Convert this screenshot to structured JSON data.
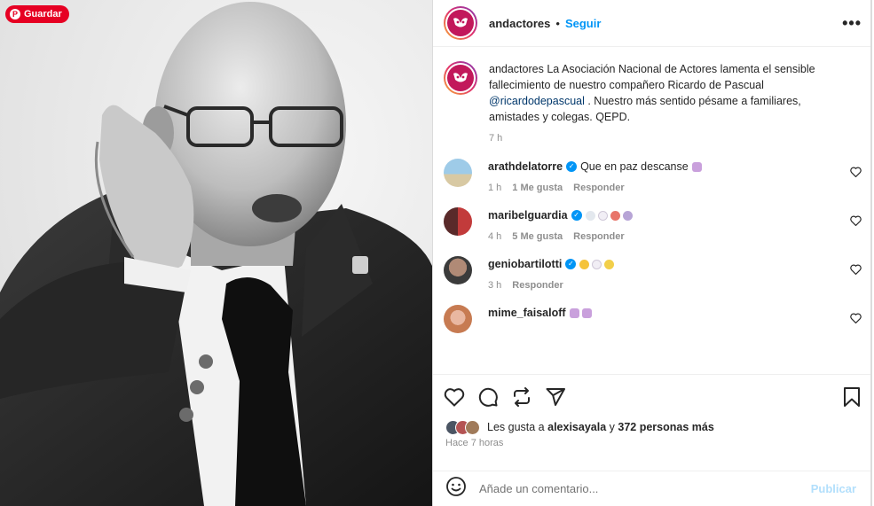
{
  "photo": {
    "save_button_label": "Guardar",
    "save_icon": "pinterest-icon"
  },
  "header": {
    "username": "andactores",
    "separator": "•",
    "follow_label": "Seguir",
    "more_label": "•••"
  },
  "caption": {
    "username": "andactores",
    "text_before": " La Asociación Nacional de Actores lamenta el sensible fallecimiento de nuestro compañero Ricardo de Pascual ",
    "mention": "@ricardodepascual",
    "text_after": " . Nuestro más sentido pésame a familiares, amistades y colegas. QEPD.",
    "time": "7 h"
  },
  "comments": [
    {
      "username": "arathdelatorre",
      "verified": true,
      "text": "Que en paz descanse",
      "emojis": [
        "folded-hands"
      ],
      "time": "1 h",
      "likes": "1 Me gusta",
      "reply": "Responder"
    },
    {
      "username": "maribelguardia",
      "verified": true,
      "text": "",
      "emojis": [
        "dove",
        "white-heart",
        "rose",
        "wing"
      ],
      "time": "4 h",
      "likes": "5 Me gusta",
      "reply": "Responder"
    },
    {
      "username": "geniobartilotti",
      "verified": true,
      "text": "",
      "emojis": [
        "sparkles",
        "white-heart",
        "dizzy"
      ],
      "time": "3 h",
      "likes": "",
      "reply": "Responder"
    },
    {
      "username": "mime_faisaloff",
      "verified": false,
      "text": "",
      "emojis": [
        "folded-hands",
        "folded-hands"
      ],
      "time": "",
      "likes": "",
      "reply": ""
    }
  ],
  "actions": {
    "icons": [
      "heart-icon",
      "comment-icon",
      "repost-icon",
      "share-icon",
      "bookmark-icon"
    ]
  },
  "likes": {
    "prefix": "Les gusta a",
    "user": "alexisayala",
    "connector": "y",
    "others": "372 personas más"
  },
  "posted": "Hace 7 horas",
  "add_comment": {
    "placeholder": "Añade un comentario...",
    "publish_label": "Publicar"
  },
  "colors": {
    "link_blue": "#0095f6",
    "mention_blue": "#00376b",
    "publish_disabled": "#b2dffc",
    "pinterest_red": "#e60023",
    "brand_magenta": "#c2185b"
  }
}
